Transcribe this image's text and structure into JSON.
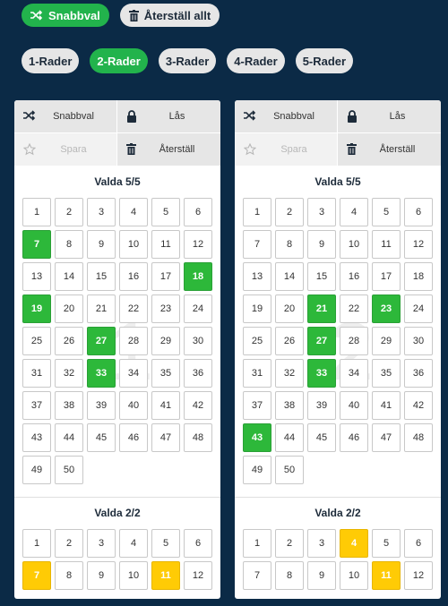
{
  "top_buttons": {
    "quick_pick_label": "Snabbval",
    "reset_all_label": "Återställ allt"
  },
  "row_buttons": [
    "1-Rader",
    "2-Rader",
    "3-Rader",
    "4-Rader",
    "5-Rader"
  ],
  "active_row_button": "2-Rader",
  "colors": {
    "accent_green": "#22b34c",
    "selected_green": "#2db83a",
    "selected_yellow": "#ffcb05",
    "background": "#0b2a46"
  },
  "cards": [
    {
      "tools": {
        "quick_pick": "Snabbval",
        "lock": "Lås",
        "save": "Spara",
        "reset": "Återställ"
      },
      "main_heading": "Valda 5/5",
      "watermark": "1",
      "main_numbers": [
        "1",
        "2",
        "3",
        "4",
        "5",
        "6",
        "7",
        "8",
        "9",
        "10",
        "11",
        "12",
        "13",
        "14",
        "15",
        "16",
        "17",
        "18",
        "19",
        "20",
        "21",
        "22",
        "23",
        "24",
        "25",
        "26",
        "27",
        "28",
        "29",
        "30",
        "31",
        "32",
        "33",
        "34",
        "35",
        "36",
        "37",
        "38",
        "39",
        "40",
        "41",
        "42",
        "43",
        "44",
        "45",
        "46",
        "47",
        "48",
        "49",
        "50"
      ],
      "main_selected": [
        "7",
        "18",
        "19",
        "27",
        "33"
      ],
      "extra_heading": "Valda 2/2",
      "extra_numbers": [
        "1",
        "2",
        "3",
        "4",
        "5",
        "6",
        "7",
        "8",
        "9",
        "10",
        "11",
        "12"
      ],
      "extra_selected": [
        "7",
        "11"
      ]
    },
    {
      "tools": {
        "quick_pick": "Snabbval",
        "lock": "Lås",
        "save": "Spara",
        "reset": "Återställ"
      },
      "main_heading": "Valda 5/5",
      "watermark": "2",
      "main_numbers": [
        "1",
        "2",
        "3",
        "4",
        "5",
        "6",
        "7",
        "8",
        "9",
        "10",
        "11",
        "12",
        "13",
        "14",
        "15",
        "16",
        "17",
        "18",
        "19",
        "20",
        "21",
        "22",
        "23",
        "24",
        "25",
        "26",
        "27",
        "28",
        "29",
        "30",
        "31",
        "32",
        "33",
        "34",
        "35",
        "36",
        "37",
        "38",
        "39",
        "40",
        "41",
        "42",
        "43",
        "44",
        "45",
        "46",
        "47",
        "48",
        "49",
        "50"
      ],
      "main_selected": [
        "21",
        "23",
        "27",
        "33",
        "43"
      ],
      "extra_heading": "Valda 2/2",
      "extra_numbers": [
        "1",
        "2",
        "3",
        "4",
        "5",
        "6",
        "7",
        "8",
        "9",
        "10",
        "11",
        "12"
      ],
      "extra_selected": [
        "4",
        "11"
      ]
    }
  ]
}
